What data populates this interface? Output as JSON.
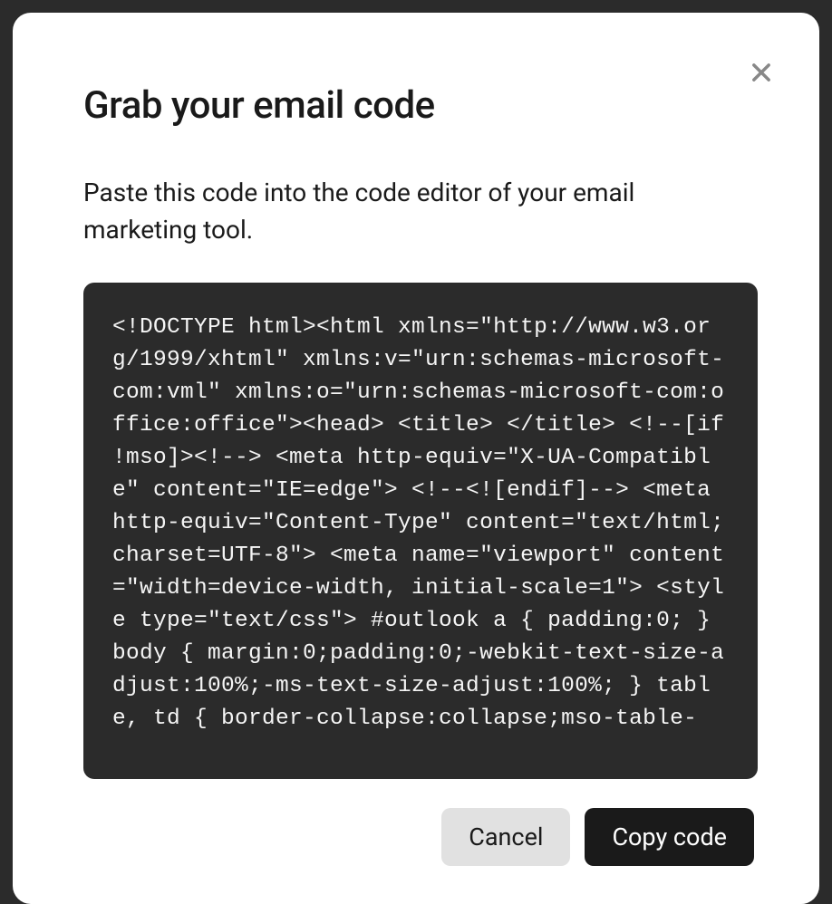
{
  "modal": {
    "title": "Grab your email code",
    "description": "Paste this code into the code editor of your email marketing tool.",
    "code": "<!DOCTYPE html><html xmlns=\"http://www.w3.org/1999/xhtml\" xmlns:v=\"urn:schemas-microsoft-com:vml\" xmlns:o=\"urn:schemas-microsoft-com:office:office\"><head> <title> </title> <!--[if !mso]><!--> <meta http-equiv=\"X-UA-Compatible\" content=\"IE=edge\"> <!--<![endif]--> <meta http-equiv=\"Content-Type\" content=\"text/html; charset=UTF-8\"> <meta name=\"viewport\" content=\"width=device-width, initial-scale=1\"> <style type=\"text/css\"> #outlook a { padding:0; } body { margin:0;padding:0;-webkit-text-size-adjust:100%;-ms-text-size-adjust:100%; } table, td { border-collapse:collapse;mso-table-",
    "buttons": {
      "cancel": "Cancel",
      "copy": "Copy code"
    }
  }
}
